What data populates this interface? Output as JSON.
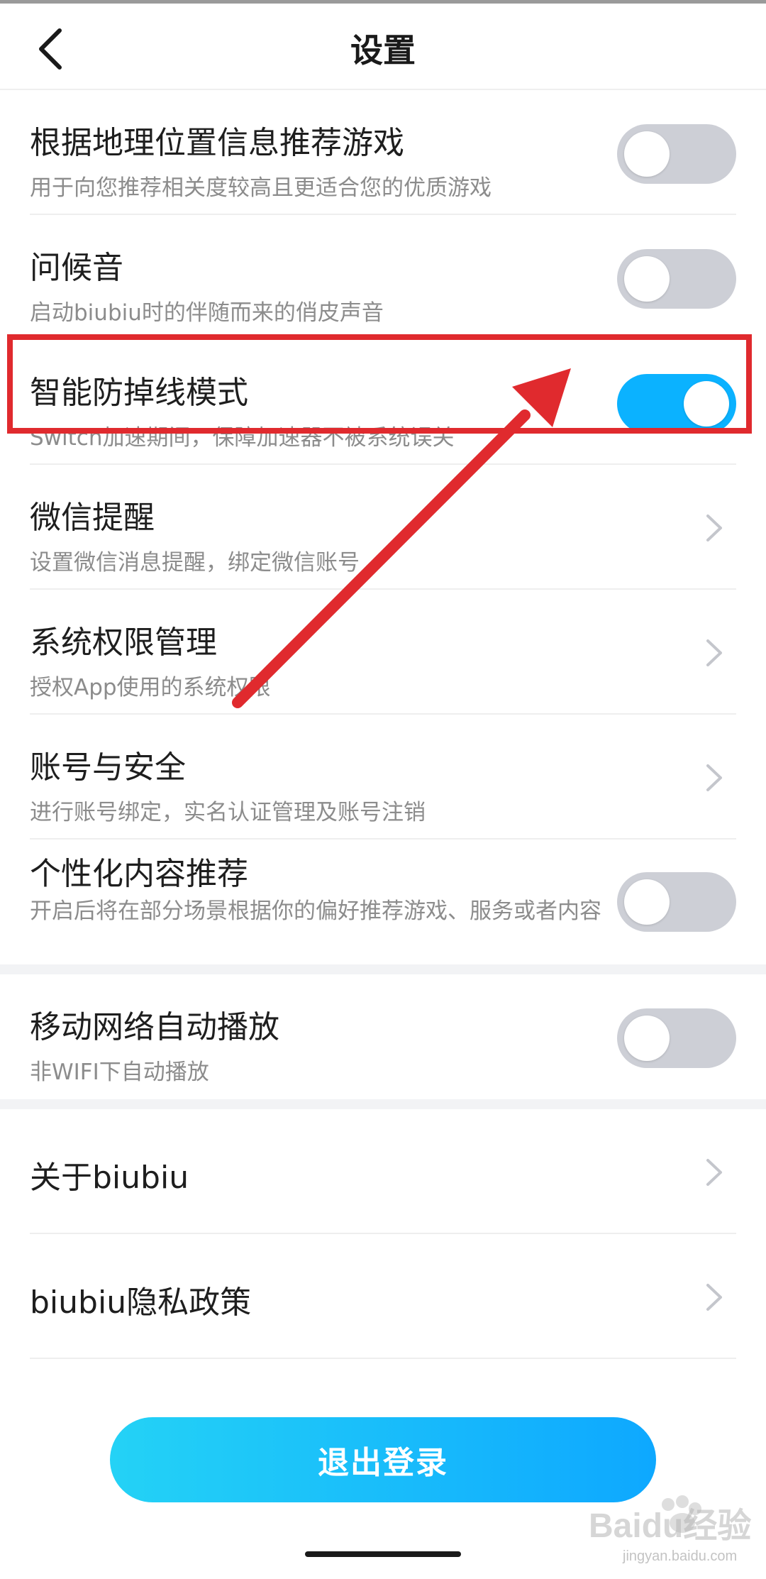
{
  "header": {
    "title": "设置"
  },
  "rows": [
    {
      "title": "根据地理位置信息推荐游戏",
      "subtitle": "用于向您推荐相关度较高且更适合您的优质游戏",
      "control": "toggle",
      "state": "off"
    },
    {
      "title": "问候音",
      "subtitle": "启动biubiu时的伴随而来的俏皮声音",
      "control": "toggle",
      "state": "off"
    },
    {
      "title": "智能防掉线模式",
      "subtitle": "Switch加速期间，保障加速器不被系统误关",
      "control": "toggle",
      "state": "on"
    },
    {
      "title": "微信提醒",
      "subtitle": "设置微信消息提醒，绑定微信账号",
      "control": "chevron"
    },
    {
      "title": "系统权限管理",
      "subtitle": "授权App使用的系统权限",
      "control": "chevron"
    },
    {
      "title": "账号与安全",
      "subtitle": "进行账号绑定，实名认证管理及账号注销",
      "control": "chevron"
    },
    {
      "title": "个性化内容推荐",
      "subtitle": "开启后将在部分场景根据你的偏好推荐游戏、服务或者内容",
      "control": "toggle",
      "state": "off"
    },
    {
      "title": "移动网络自动播放",
      "subtitle": "非WIFI下自动播放",
      "control": "toggle",
      "state": "off"
    },
    {
      "title": "关于biubiu",
      "control": "chevron"
    },
    {
      "title": "biubiu隐私政策",
      "control": "chevron"
    }
  ],
  "logout_label": "退出登录",
  "watermark": {
    "text": "Baidu经验",
    "url_text": "jingyan.baidu.com"
  },
  "colors": {
    "accent": "#0bb2ff",
    "annotation": "#e02a2e",
    "toggle_off": "#cdcfd6"
  }
}
